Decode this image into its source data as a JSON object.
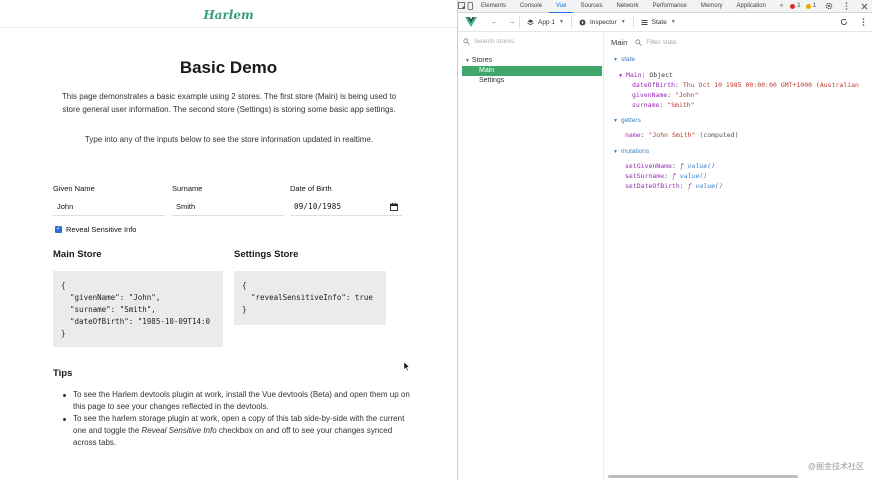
{
  "page": {
    "logo": "Harlem",
    "title": "Basic Demo",
    "intro": "This page demonstrates a basic example using 2 stores. The first store (Main) is being used to store general user information. The second store (Settings) is storing some basic app settings.",
    "instructions": "Type into any of the inputs below to see the store information updated in realtime.",
    "form": {
      "given_name_label": "Given Name",
      "given_name_value": "John",
      "surname_label": "Surname",
      "surname_value": "Smith",
      "dob_label": "Date of Birth",
      "dob_value": "09/10/1985"
    },
    "reveal_checkbox": {
      "label": "Reveal Sensitive Info",
      "checked": true
    },
    "main_store": {
      "heading": "Main Store",
      "code": "{\n  \"givenName\": \"John\",\n  \"surname\": \"Smith\",\n  \"dateOfBirth\": \"1985-10-09T14:0\n}"
    },
    "settings_store": {
      "heading": "Settings Store",
      "code": "{\n  \"revealSensitiveInfo\": true\n}"
    },
    "tips": {
      "heading": "Tips",
      "tip1": "To see the Harlem devtools plugin at work, install the Vue devtools (Beta) and open them up on this page to see your changes reflected in the devtools.",
      "tip2_before": "To see the harlem storage plugin at work, open a copy of this tab side-by-side with the current one and toggle the ",
      "tip2_italic": "Reveal Sensitive Info",
      "tip2_after": " checkbox on and off to see your changes synced across tabs."
    }
  },
  "devtools": {
    "tabs": [
      "Elements",
      "Console",
      "Vue",
      "Sources",
      "Network",
      "Performance",
      "Memory",
      "Application"
    ],
    "more_tabs": "»",
    "error_count": "1",
    "warning_count": "1",
    "toolbar": {
      "app_label": "App 1",
      "inspector_label": "Inspector",
      "state_label": "State"
    },
    "stores": {
      "search_placeholder": "Search stores",
      "root_label": "Stores",
      "items": [
        "Main",
        "Settings"
      ]
    },
    "state_view": {
      "selected_store": "Main",
      "filter_placeholder": "Filter state",
      "state_heading": "state",
      "main_key": "Main",
      "main_type": "Object",
      "date_key": "dateOfBirth",
      "date_value": "Thu Oct 10 1985 00:00:00 GMT+1000 (Australian",
      "given_key": "givenName",
      "given_value": "\"John\"",
      "surname_key": "surname",
      "surname_value": "\"Smith\"",
      "getters_heading": "getters",
      "getter_key": "name",
      "getter_value": "\"John Smith\"",
      "getter_note": "(computed)",
      "mutations_heading": "mutations",
      "mutations": [
        "setGivenName",
        "setSurname",
        "setDateOfBirth"
      ],
      "fn_sign": "ƒ",
      "fn_value": "value()"
    }
  },
  "watermark": "@掘金技术社区",
  "colors": {
    "brand_green": "#3a9d7a",
    "vue_green": "#3fa76a",
    "devtools_blue": "#1a73e8",
    "key_purple": "#9a2bb5",
    "string_red": "#c0392b"
  }
}
